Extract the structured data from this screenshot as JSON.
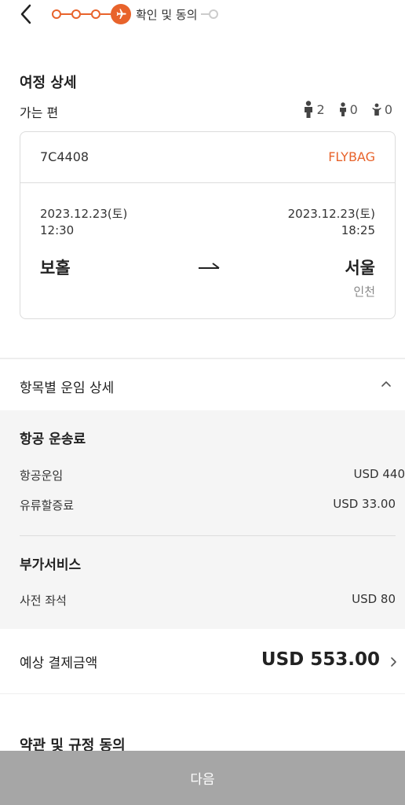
{
  "header": {
    "step_label": "확인 및 동의",
    "back_icon": "chevron-left-icon",
    "active_step_icon": "airplane-icon",
    "accent_color": "#e8632b"
  },
  "itinerary": {
    "title": "여정 상세",
    "direction_label": "가는 편",
    "passengers": {
      "adult": "2",
      "child": "0",
      "infant": "0"
    },
    "flight_number": "7C4408",
    "fare_type": "FLYBAG",
    "departure": {
      "date": "2023.12.23(토)",
      "time": "12:30",
      "city": "보홀"
    },
    "arrival": {
      "date": "2023.12.23(토)",
      "time": "18:25",
      "city": "서울",
      "airport": "인천"
    }
  },
  "fare_details": {
    "title": "항목별 운임 상세",
    "groups": [
      {
        "title": "항공 운송료",
        "rows": [
          {
            "label": "항공운임",
            "value": "USD 440"
          },
          {
            "label": "유류할증료",
            "value": "USD 33.00"
          }
        ]
      },
      {
        "title": "부가서비스",
        "rows": [
          {
            "label": "사전 좌석",
            "value": "USD 80"
          }
        ]
      }
    ]
  },
  "total": {
    "label": "예상 결제금액",
    "value": "USD 553.00"
  },
  "terms": {
    "title": "약관 및 규정 동의"
  },
  "footer": {
    "next_label": "다음",
    "button_color": "#a6a6a6"
  }
}
